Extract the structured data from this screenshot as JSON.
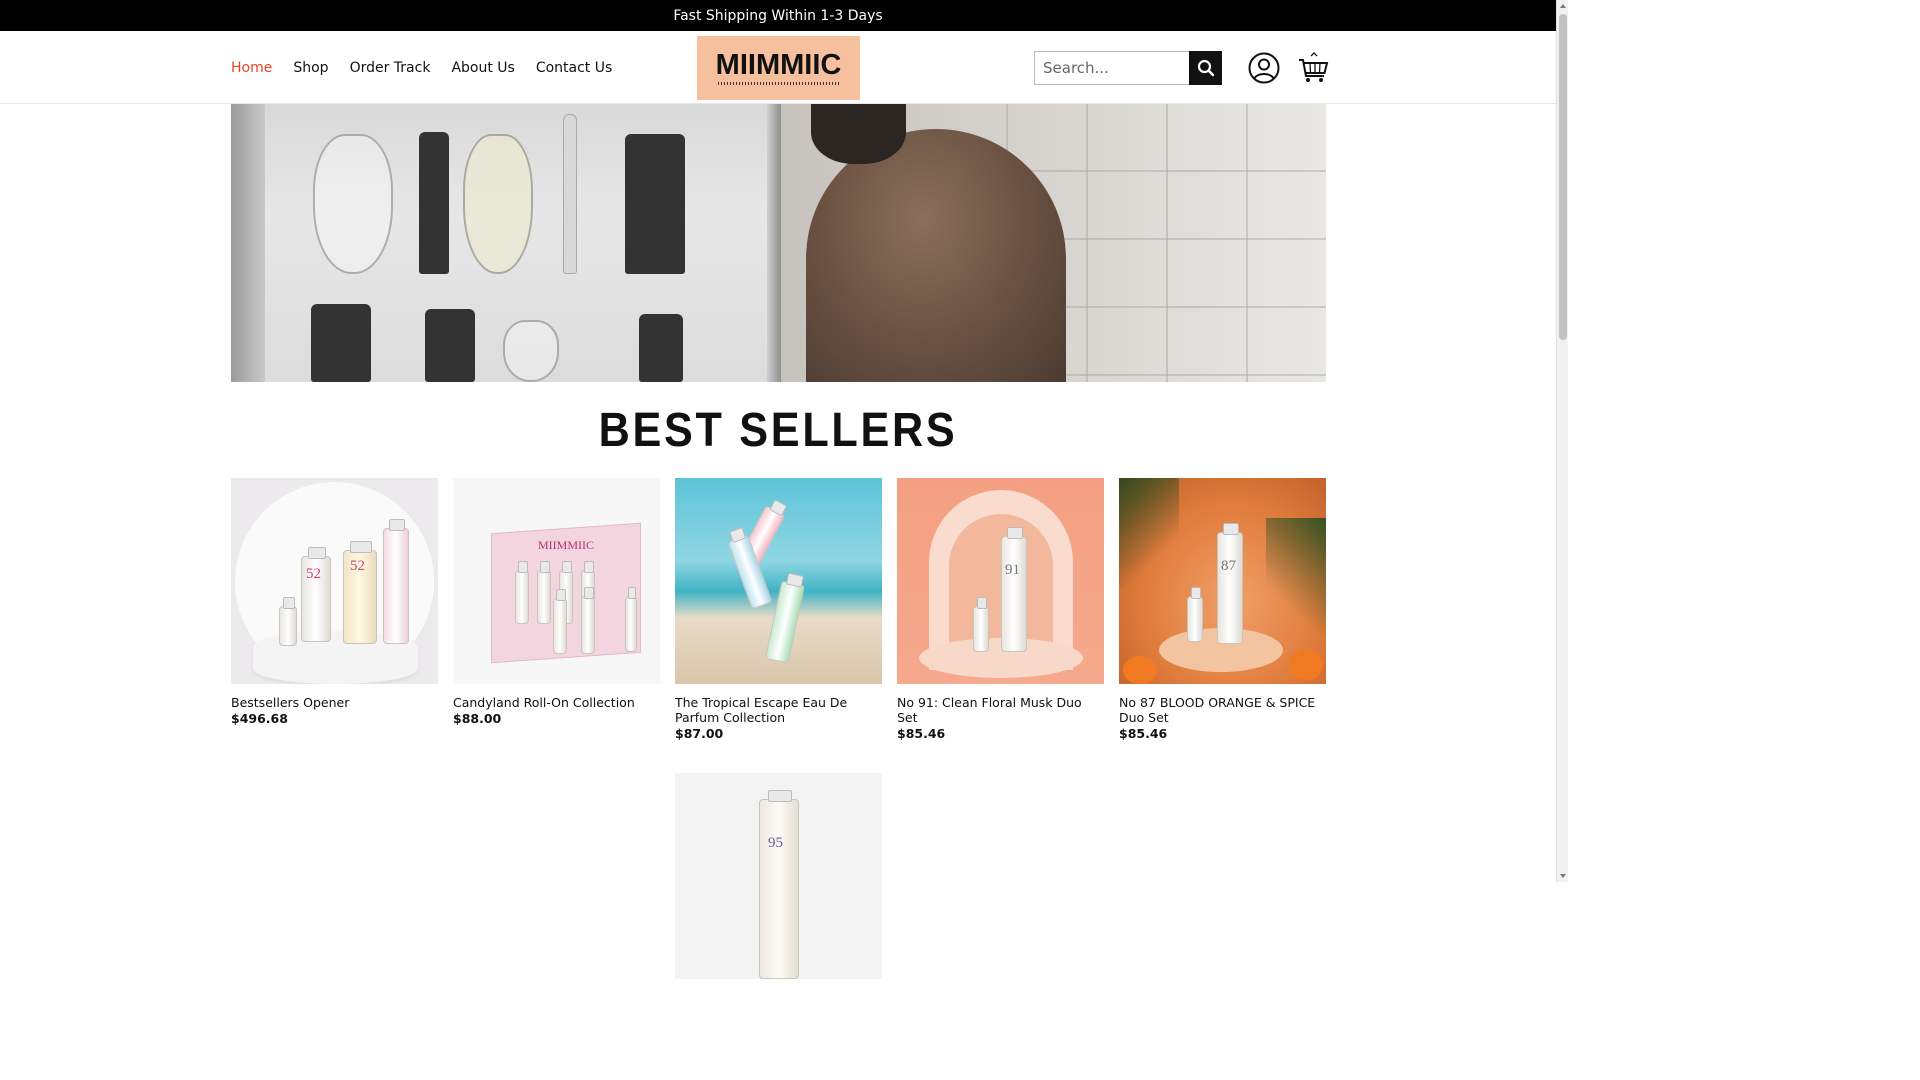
{
  "announcement": "Fast Shipping Within 1-3 Days",
  "nav": {
    "items": [
      {
        "label": "Home",
        "active": true
      },
      {
        "label": "Shop",
        "active": false
      },
      {
        "label": "Order Track",
        "active": false
      },
      {
        "label": "About Us",
        "active": false
      },
      {
        "label": "Contact Us",
        "active": false
      }
    ]
  },
  "logo": {
    "text": "MIIMMIIC"
  },
  "search": {
    "placeholder": "Search..."
  },
  "icons": {
    "search": "search-icon",
    "account": "user-icon",
    "cart": "cart-icon"
  },
  "section": {
    "title": "BEST SELLERS"
  },
  "products": [
    {
      "name": "Bestsellers Opener",
      "price": "$496.68"
    },
    {
      "name": "Candyland Roll-On Collection",
      "price": "$88.00"
    },
    {
      "name": "The Tropical Escape Eau De Parfum Collection",
      "price": "$87.00"
    },
    {
      "name": "No 91: Clean Floral Musk Duo Set",
      "price": "$85.46"
    },
    {
      "name": "No 87 BLOOD ORANGE & SPICE Duo Set",
      "price": "$85.46"
    }
  ],
  "colors": {
    "accent": "#e8471c",
    "logo_bg": "#f6bf9e",
    "topbar": "#000000"
  }
}
